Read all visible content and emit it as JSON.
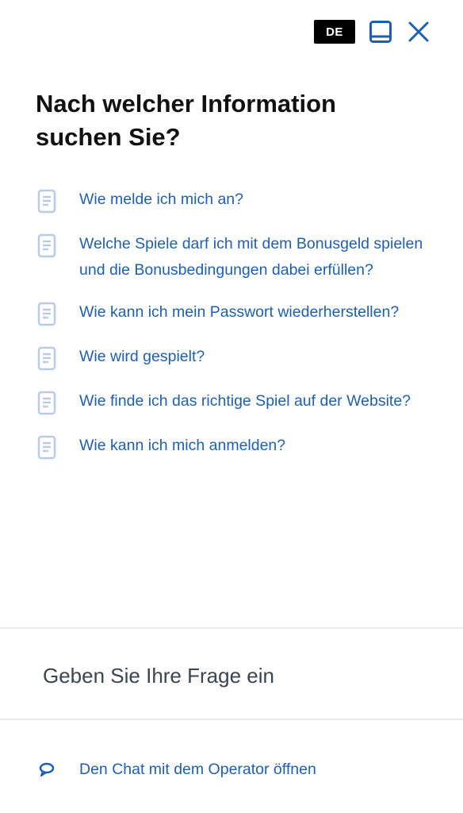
{
  "header": {
    "language": "DE",
    "minimize_icon": "window-minimize-icon",
    "close_icon": "close-icon"
  },
  "title": "Nach welcher Information suchen Sie?",
  "faq": {
    "icon": "document-icon",
    "items": [
      {
        "label": "Wie melde ich mich an?"
      },
      {
        "label": "Welche Spiele darf ich mit dem Bonusgeld spielen und die Bonusbedingungen dabei erfüllen?"
      },
      {
        "label": "Wie kann ich mein Passwort wiederherstellen?"
      },
      {
        "label": "Wie wird gespielt?"
      },
      {
        "label": "Wie finde ich das richtige Spiel auf der Website?"
      },
      {
        "label": "Wie kann ich mich anmelden?"
      }
    ]
  },
  "question": {
    "placeholder": "Geben Sie Ihre Frage ein"
  },
  "chat": {
    "icon": "chat-bubble-icon",
    "label": "Den Chat mit dem Operator öffnen"
  },
  "colors": {
    "link": "#1f5fb3",
    "icon_blue": "#1f5fb3",
    "doc_icon": "#b9cbe6",
    "divider": "#e6eaf0",
    "badge_bg": "#000000"
  }
}
